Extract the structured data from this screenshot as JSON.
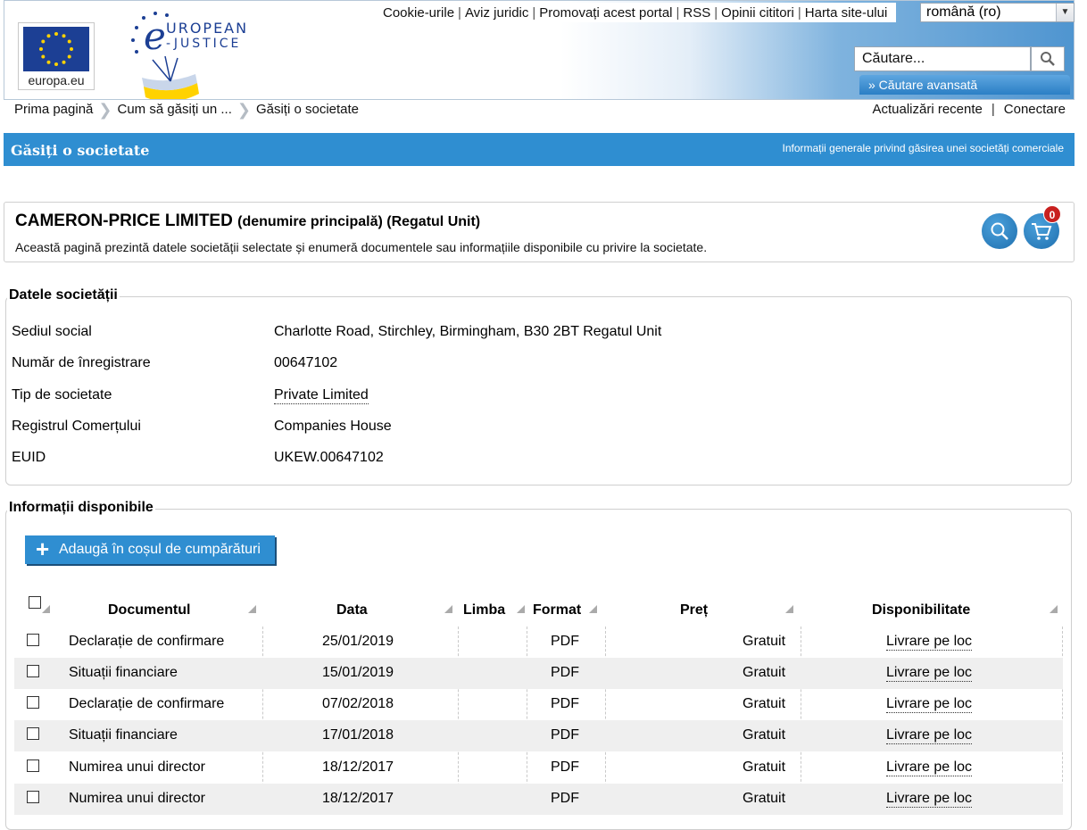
{
  "header": {
    "europa_label": "europa.eu",
    "top_links": [
      "Cookie-urile",
      "Aviz juridic",
      "Promovați acest portal",
      "RSS",
      "Opinii cititori",
      "Harta site-ului"
    ],
    "language": "română (ro)",
    "search_placeholder": "Căutare...",
    "advanced_search": "» Căutare avansată",
    "brand_colors": {
      "blue": "#2f8ed1",
      "flag": "#1c3f94",
      "star": "#ffd200"
    }
  },
  "breadcrumb": {
    "items": [
      "Prima pagină",
      "Cum să găsiți un ...",
      "Găsiți o societate"
    ],
    "right_links": [
      "Actualizări recente",
      "Conectare"
    ]
  },
  "titlebar": {
    "title": "Găsiți o societate",
    "right_link": "Informații generale privind găsirea unei societăți comerciale"
  },
  "company": {
    "name": "CAMERON-PRICE LIMITED",
    "name_suffix": "(denumire principală) (Regatul Unit)",
    "description": "Această pagină prezintă datele societății selectate și enumeră documentele sau informațiile disponibile cu privire la societate.",
    "cart_count": "0"
  },
  "details": {
    "legend": "Datele societății",
    "rows": [
      {
        "label": "Sediul social",
        "value": "Charlotte Road, Stirchley, Birmingham, B30 2BT Regatul Unit"
      },
      {
        "label": "Număr de înregistrare",
        "value": "00647102"
      },
      {
        "label": "Tip de societate",
        "value": "Private Limited"
      },
      {
        "label": "Registrul Comerțului",
        "value": "Companies House"
      },
      {
        "label": "EUID",
        "value": "UKEW.00647102"
      }
    ]
  },
  "available": {
    "legend": "Informații disponibile",
    "add_to_cart": "Adaugă în coșul de cumpărături",
    "columns": [
      "Documentul",
      "Data",
      "Limba",
      "Format",
      "Preț",
      "Disponibilitate"
    ],
    "rows": [
      {
        "doc": "Declarație de confirmare",
        "date": "25/01/2019",
        "lang": "",
        "format": "PDF",
        "price": "Gratuit",
        "avail": "Livrare pe loc"
      },
      {
        "doc": "Situații financiare",
        "date": "15/01/2019",
        "lang": "",
        "format": "PDF",
        "price": "Gratuit",
        "avail": "Livrare pe loc"
      },
      {
        "doc": "Declarație de confirmare",
        "date": "07/02/2018",
        "lang": "",
        "format": "PDF",
        "price": "Gratuit",
        "avail": "Livrare pe loc"
      },
      {
        "doc": "Situații financiare",
        "date": "17/01/2018",
        "lang": "",
        "format": "PDF",
        "price": "Gratuit",
        "avail": "Livrare pe loc"
      },
      {
        "doc": "Numirea unui director",
        "date": "18/12/2017",
        "lang": "",
        "format": "PDF",
        "price": "Gratuit",
        "avail": "Livrare pe loc"
      },
      {
        "doc": "Numirea unui director",
        "date": "18/12/2017",
        "lang": "",
        "format": "PDF",
        "price": "Gratuit",
        "avail": "Livrare pe loc"
      }
    ]
  }
}
